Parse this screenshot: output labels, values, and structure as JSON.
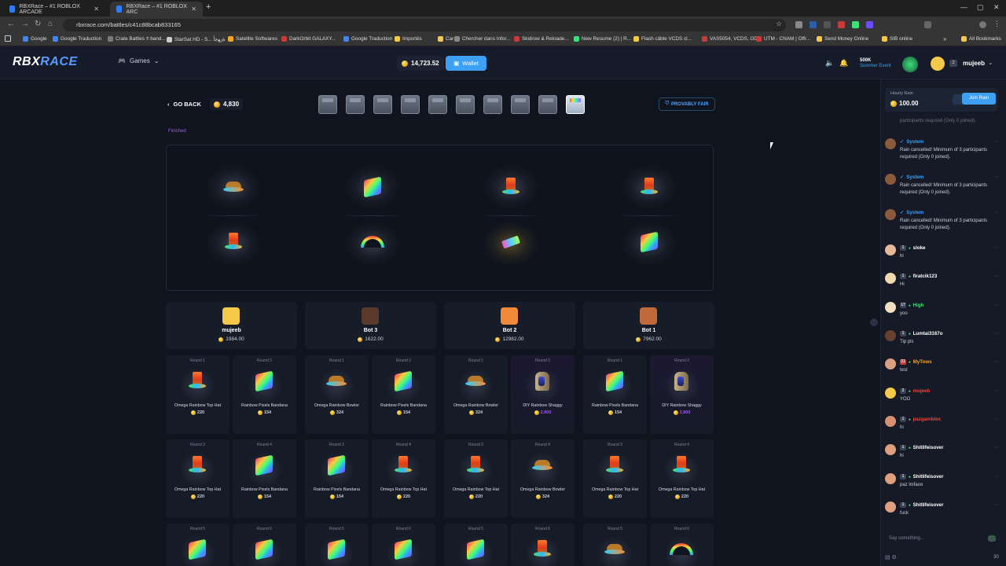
{
  "browser": {
    "tabs": [
      {
        "title": "RBXRace – #1 ROBLOX ARCADE"
      },
      {
        "title": "RBXRace – #1 ROBLOX ARC"
      }
    ],
    "url": "rbxrace.com/battles/c41c88bcab833165",
    "bookmarks": [
      "Google",
      "Google Traduction",
      "Crate Battles ≡ band...",
      "StarSat HD - S... ﺓﺯﻬﺟﺃ",
      "Satellite Softwares",
      "DarkOrbit GALAXY...",
      "Google Traduction",
      "Importés",
      "Car",
      "Chercher dans Infor...",
      "Skidrow & Reloade...",
      "New Resume (2) | R...",
      "Flash câble VCDS cl...",
      "VAS5054, VCDS, OD...",
      "UTM - CNAM | Offr...",
      "Send Money Online",
      "SIB online",
      "All Bookmarks"
    ]
  },
  "header": {
    "logo_left": "RBX",
    "logo_right": "RACE",
    "games_label": "Games",
    "balance": "14,723.52",
    "wallet_label": "Wallet",
    "event_amount": "500K",
    "event_name": "Summer Event",
    "user_level": "2",
    "username": "mujeeb"
  },
  "battle": {
    "go_back_label": "GO BACK",
    "cost": "4,830",
    "provably_fair_label": "PROVABLY FAIR",
    "status": "Finished",
    "players": [
      {
        "name": "mujeeb",
        "total": "1984.00",
        "avatar_color": "#f5c84a"
      },
      {
        "name": "Bot 3",
        "total": "1622.00",
        "avatar_color": "#5a3a2a"
      },
      {
        "name": "Bot 2",
        "total": "12982.00",
        "avatar_color": "#f08a3a"
      },
      {
        "name": "Bot 1",
        "total": "7962.00",
        "avatar_color": "#c06a3a"
      }
    ],
    "rows": [
      [
        {
          "round": "Round 1",
          "name": "Omega Rainbow Top Hat",
          "price": "220",
          "item": "hat"
        },
        {
          "round": "Round 2",
          "name": "Rainbow Pixels Bandana",
          "price": "154",
          "item": "bandana"
        },
        {
          "round": "Round 1",
          "name": "Omega Rainbow Bowler",
          "price": "324",
          "item": "bowler"
        },
        {
          "round": "Round 2",
          "name": "Rainbow Pixels Bandana",
          "price": "154",
          "item": "bandana"
        },
        {
          "round": "Round 1",
          "name": "Omega Rainbow Bowler",
          "price": "324",
          "item": "bowler"
        },
        {
          "round": "Round 2",
          "name": "DIY Rainbow Shaggy",
          "price": "2,800",
          "item": "shaggy",
          "rare": true
        },
        {
          "round": "Round 1",
          "name": "Rainbow Pixels Bandana",
          "price": "154",
          "item": "bandana"
        },
        {
          "round": "Round 2",
          "name": "DIY Rainbow Shaggy",
          "price": "2,800",
          "item": "shaggy",
          "rare": true
        }
      ],
      [
        {
          "round": "Round 3",
          "name": "Omega Rainbow Top Hat",
          "price": "220",
          "item": "hat"
        },
        {
          "round": "Round 4",
          "name": "Rainbow Pixels Bandana",
          "price": "154",
          "item": "bandana"
        },
        {
          "round": "Round 3",
          "name": "Rainbow Pixels Bandana",
          "price": "154",
          "item": "bandana"
        },
        {
          "round": "Round 4",
          "name": "Omega Rainbow Top Hat",
          "price": "220",
          "item": "hat"
        },
        {
          "round": "Round 3",
          "name": "Omega Rainbow Top Hat",
          "price": "220",
          "item": "hat"
        },
        {
          "round": "Round 4",
          "name": "Omega Rainbow Bowler",
          "price": "324",
          "item": "bowler"
        },
        {
          "round": "Round 3",
          "name": "Omega Rainbow Top Hat",
          "price": "220",
          "item": "hat"
        },
        {
          "round": "Round 4",
          "name": "Omega Rainbow Top Hat",
          "price": "220",
          "item": "hat"
        }
      ],
      [
        {
          "round": "Round 5",
          "item": "bandana"
        },
        {
          "round": "Round 6",
          "item": "bandana"
        },
        {
          "round": "Round 5",
          "item": "bandana"
        },
        {
          "round": "Round 6",
          "item": "bandana"
        },
        {
          "round": "Round 5",
          "item": "bandana"
        },
        {
          "round": "Round 6",
          "item": "hat"
        },
        {
          "round": "Round 5",
          "item": "bowler"
        },
        {
          "round": "Round 6",
          "item": "rainbow"
        }
      ]
    ]
  },
  "chat": {
    "rain_title": "Hourly Rain",
    "rain_amount": "100.00",
    "join_rain_label": "Join Rain",
    "partial_message": "participants required (Only 0 joined).",
    "messages": [
      {
        "user": "System",
        "verified": true,
        "text": "Rain cancelled! Minimum of 3 participants required (Only 0 joined).",
        "name_color": "#3ea0f2",
        "avatar": "#8a5a3a"
      },
      {
        "user": "System",
        "verified": true,
        "text": "Rain cancelled! Minimum of 3 participants required (Only 0 joined).",
        "name_color": "#3ea0f2",
        "avatar": "#8a5a3a"
      },
      {
        "user": "System",
        "verified": true,
        "text": "Rain cancelled! Minimum of 3 participants required (Only 0 joined).",
        "name_color": "#3ea0f2",
        "avatar": "#8a5a3a"
      },
      {
        "user": "sloke",
        "level": "1",
        "text": "hi",
        "name_color": "#ffffff",
        "avatar": "#e8b89a"
      },
      {
        "user": "firatcik123",
        "level": "1",
        "text": "Hi",
        "name_color": "#ffffff",
        "avatar": "#f0d8b0"
      },
      {
        "user": "High",
        "level": "17",
        "text": "yoo",
        "name_color": "#3be07a",
        "avatar": "#f0e0c0"
      },
      {
        "user": "Lumtai3167o",
        "level": "1",
        "text": "Tip pls",
        "name_color": "#ffffff",
        "avatar": "#6a4030"
      },
      {
        "user": "MyTows",
        "level": "31",
        "level_style": "red",
        "text": "test",
        "name_color": "#f5a623",
        "avatar": "#d8a080"
      },
      {
        "user": "mujeeb",
        "level": "2",
        "text": "YOO",
        "name_color": "#e8463c",
        "avatar": "#f5c84a"
      },
      {
        "user": "pazgamblex",
        "level": "1",
        "text": "hi",
        "name_color": "#e8463c",
        "avatar": "#d89070"
      },
      {
        "user": "Shitlifeisover",
        "level": "1",
        "text": "hi",
        "name_color": "#ffffff",
        "avatar": "#e0a080"
      },
      {
        "user": "Shitlifeisover",
        "level": "1",
        "text": "paz lmfaoo",
        "name_color": "#ffffff",
        "avatar": "#e0a080"
      },
      {
        "user": "Shitlifeisover",
        "level": "1",
        "text": "fuck",
        "name_color": "#ffffff",
        "avatar": "#e0a080"
      }
    ],
    "input_placeholder": "Say something...",
    "online_count": "30"
  },
  "colors": {
    "accent": "#3ea0f2",
    "page_bg": "#10141f",
    "panel": "#171c29",
    "rare": "#a64dff"
  }
}
